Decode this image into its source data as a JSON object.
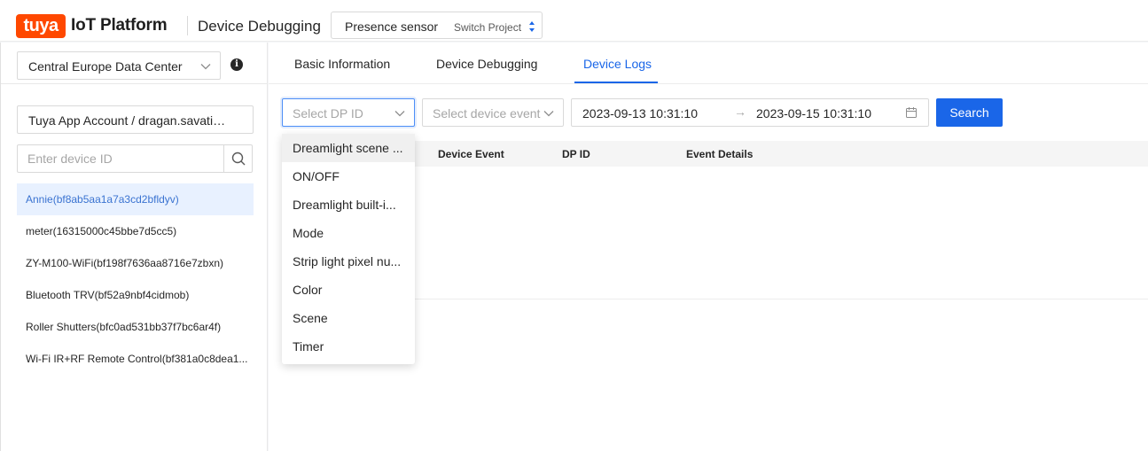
{
  "header": {
    "logo_text": "tuya",
    "platform_name": "IoT Platform",
    "page_title": "Device Debugging",
    "project_name": "Presence sensor",
    "switch_project_label": "Switch Project",
    "brand_color": "#ff4800"
  },
  "sidebar": {
    "data_center": "Central Europe Data Center",
    "account": "Tuya App Account / dragan.savatic@gmail.com",
    "device_search_placeholder": "Enter device ID",
    "devices": [
      {
        "label": "Annie(bf8ab5aa1a7a3cd2bfldyv)",
        "active": true
      },
      {
        "label": "meter(16315000c45bbe7d5cc5)"
      },
      {
        "label": "ZY-M100-WiFi(bf198f7636aa8716e7zbxn)"
      },
      {
        "label": "Bluetooth TRV(bf52a9nbf4cidmob)"
      },
      {
        "label": "Roller Shutters(bfc0ad531bb37f7bc6ar4f)"
      },
      {
        "label": "Wi-Fi IR+RF Remote Control(bf381a0c8dea1..."
      }
    ]
  },
  "tabs": [
    {
      "label": "Basic Information"
    },
    {
      "label": "Device Debugging"
    },
    {
      "label": "Device Logs",
      "active": true
    }
  ],
  "filters": {
    "dp_placeholder": "Select DP ID",
    "event_placeholder": "Select device event",
    "start_time": "2023-09-13 10:31:10",
    "end_time": "2023-09-15 10:31:10",
    "range_separator": "→",
    "search_label": "Search",
    "accent_color": "#1a66e8"
  },
  "table": {
    "columns": [
      "Device Event",
      "DP ID",
      "Event Details"
    ]
  },
  "dp_dropdown": {
    "options": [
      "Dreamlight scene ...",
      "ON/OFF",
      "Dreamlight built-i...",
      "Mode",
      "Strip light pixel nu...",
      "Color",
      "Scene",
      "Timer"
    ]
  }
}
